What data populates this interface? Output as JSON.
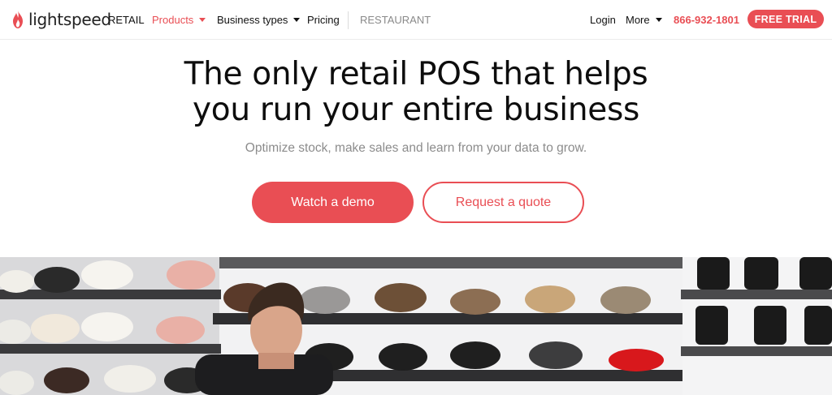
{
  "nav": {
    "logo_text": "lightspeed",
    "items": {
      "retail": "RETAIL",
      "products": "Products",
      "business_types": "Business types",
      "pricing": "Pricing",
      "restaurant": "RESTAURANT",
      "login": "Login",
      "more": "More"
    },
    "phone": "866-932-1801",
    "cta": "FREE TRIAL"
  },
  "hero": {
    "headline_line1": "The only retail POS that helps",
    "headline_line2": "you run your entire business",
    "subhead": "Optimize stock, make sales and learn from your data to grow.",
    "primary_button": "Watch a demo",
    "secondary_button": "Request a quote"
  },
  "colors": {
    "brand": "#e94e54",
    "text": "#111111",
    "muted": "#8c8c8c"
  },
  "icons": {
    "logo": "flame-icon",
    "dropdown": "caret-down-icon"
  }
}
